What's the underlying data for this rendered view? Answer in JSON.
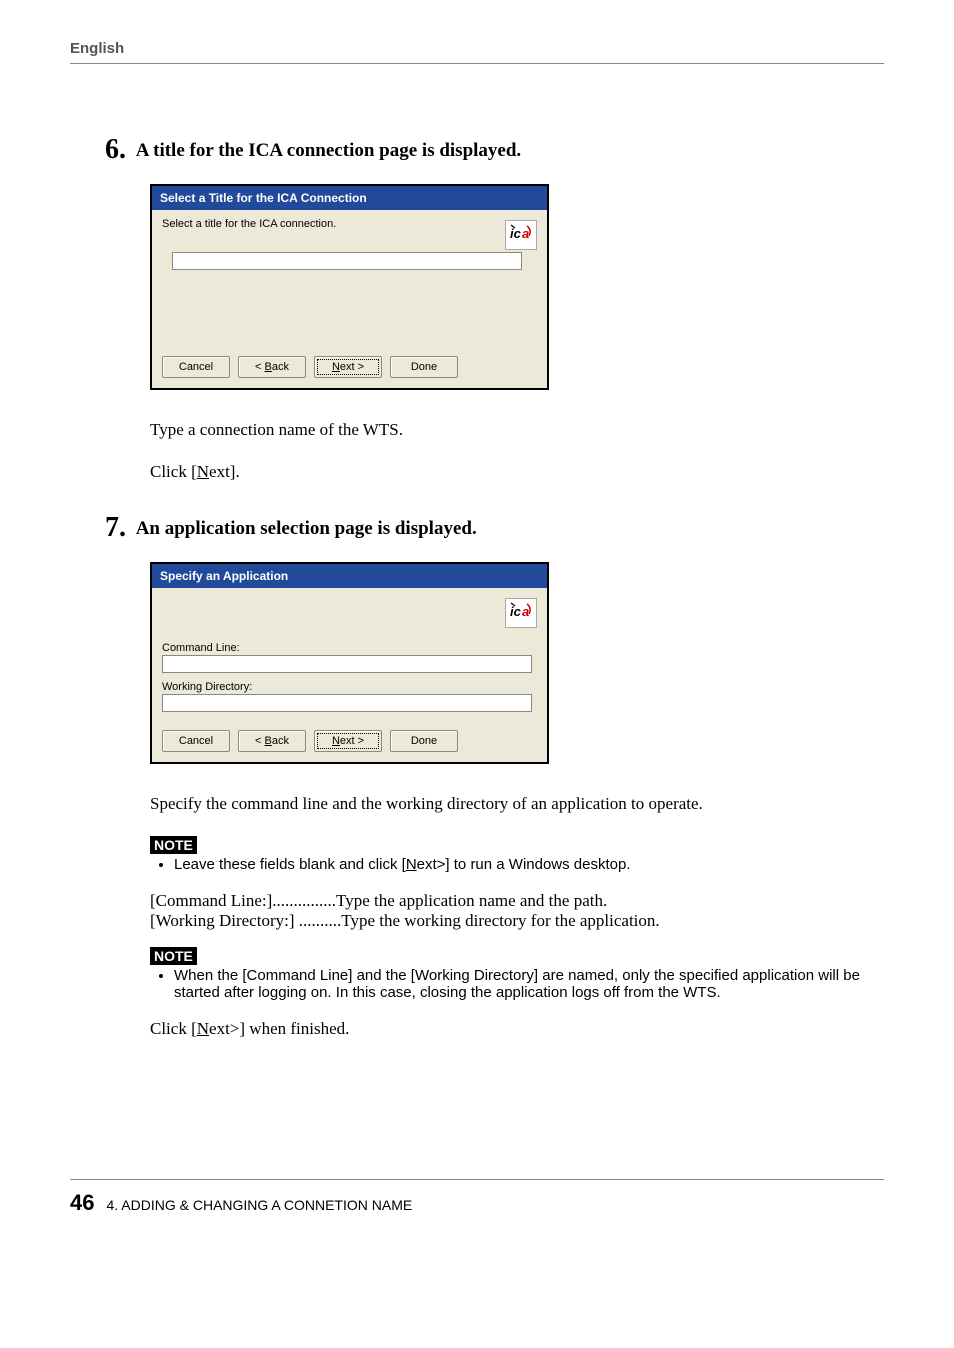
{
  "header": "English",
  "step6": {
    "num": "6.",
    "title": "A title for the ICA connection page is displayed.",
    "dialog": {
      "title": "Select a Title for the ICA Connection",
      "instruction": "Select a title for the ICA connection.",
      "input_value": "",
      "buttons": {
        "cancel": "Cancel",
        "back_prefix": "< ",
        "back_u": "B",
        "back_suffix": "ack",
        "next_u": "N",
        "next_suffix": "ext >",
        "done": "Done"
      }
    },
    "after1": "Type a connection name of the WTS.",
    "after2_pre": "Click [",
    "after2_u": "N",
    "after2_suf": "ext]."
  },
  "step7": {
    "num": "7.",
    "title": "An application selection page is displayed.",
    "dialog": {
      "title": "Specify an Application",
      "cmd_label": "Command Line:",
      "cmd_value": "",
      "wd_label": "Working Directory:",
      "wd_value": "",
      "buttons": {
        "cancel": "Cancel",
        "back_prefix": "< ",
        "back_u": "B",
        "back_suffix": "ack",
        "next_u": "N",
        "next_suffix": "ext >",
        "done": "Done"
      }
    },
    "after1": "Specify the command line and the working directory of an application to operate.",
    "note1_label": "NOTE",
    "note1_bullet_pre": "Leave these fields blank and click [",
    "note1_bullet_u": "N",
    "note1_bullet_suf": "ext>] to run a Windows desktop.",
    "def_cmd": "[Command Line:]...............Type the application name and the path.",
    "def_wd": "[Working Directory:] ..........Type the working directory for the application.",
    "note2_label": "NOTE",
    "note2_bullet": "When the [Command Line] and the [Working Directory] are named, only the specified application will be started after logging on.  In this case, closing the application logs off from the WTS.",
    "final_pre": "Click [",
    "final_u": "N",
    "final_suf": "ext>] when finished."
  },
  "footer": {
    "page": "46",
    "chapter": "4. ADDING & CHANGING A CONNETION NAME"
  },
  "icon_name": "ica-icon"
}
